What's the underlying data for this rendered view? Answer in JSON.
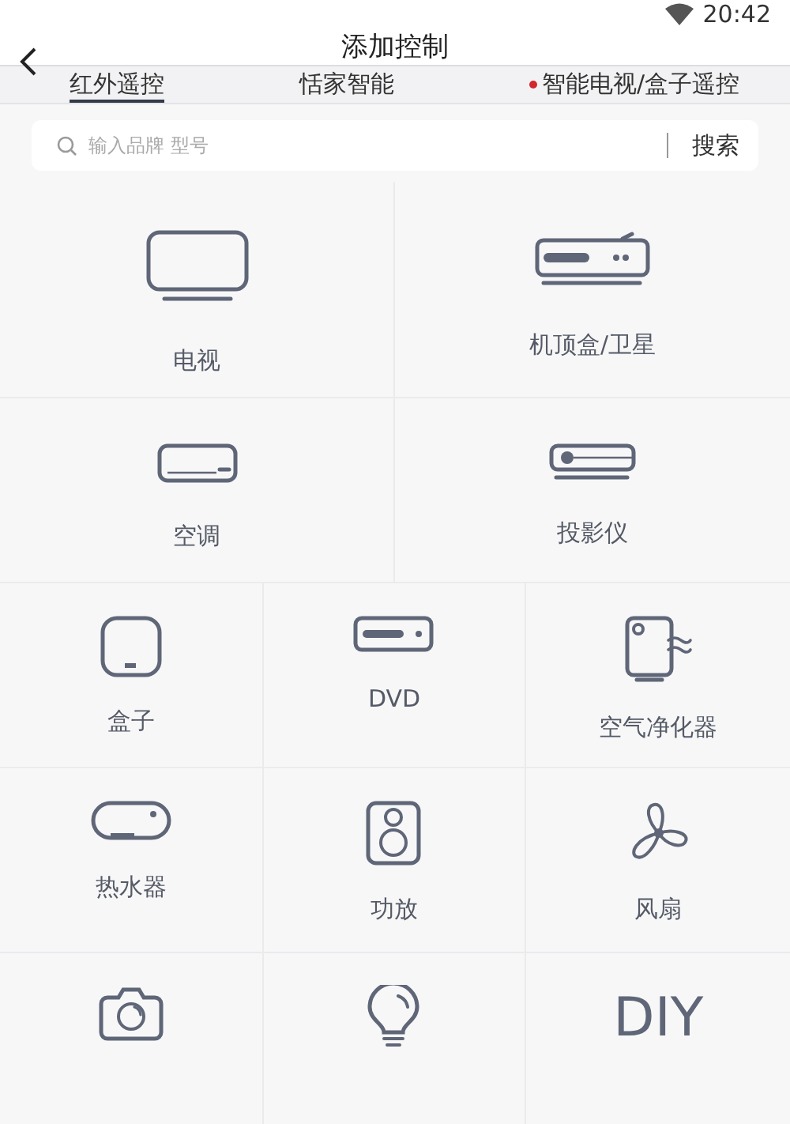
{
  "status_bar": {
    "time": "20:42"
  },
  "header": {
    "title": "添加控制"
  },
  "tabs": [
    {
      "label": "红外遥控",
      "selected": true,
      "dot": false
    },
    {
      "label": "恬家智能",
      "selected": false,
      "dot": false
    },
    {
      "label": "智能电视/盒子遥控",
      "selected": false,
      "dot": true
    }
  ],
  "search": {
    "placeholder": "输入品牌 型号",
    "button": "搜索"
  },
  "rows": [
    [
      {
        "kind": "tv",
        "label": "电视"
      },
      {
        "kind": "settop",
        "label": "机顶盒/卫星"
      }
    ],
    [
      {
        "kind": "ac",
        "label": "空调"
      },
      {
        "kind": "projector",
        "label": "投影仪"
      }
    ],
    [
      {
        "kind": "box",
        "label": "盒子"
      },
      {
        "kind": "dvd",
        "label": "DVD"
      },
      {
        "kind": "purifier",
        "label": "空气净化器"
      }
    ],
    [
      {
        "kind": "heater",
        "label": "热水器"
      },
      {
        "kind": "amp",
        "label": "功放"
      },
      {
        "kind": "fan",
        "label": "风扇"
      }
    ],
    [
      {
        "kind": "camera"
      },
      {
        "kind": "bulb"
      },
      {
        "kind": "text",
        "glyph": "DIY"
      }
    ]
  ]
}
